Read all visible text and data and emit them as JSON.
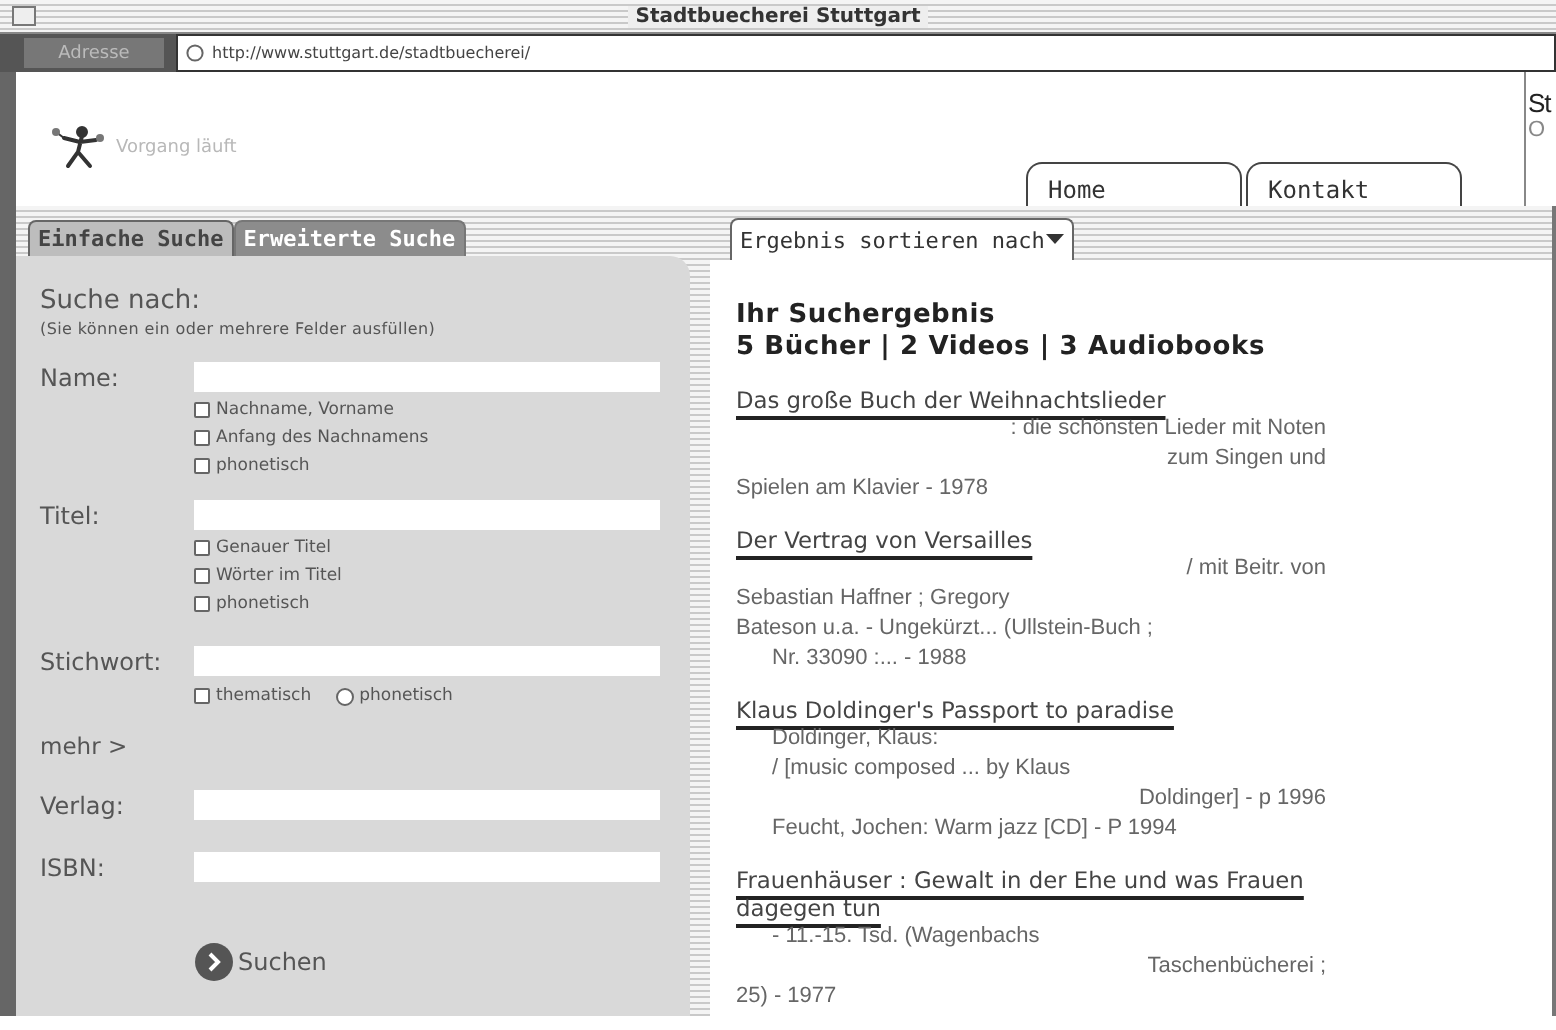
{
  "window": {
    "title": "Stadtbuecherei Stuttgart"
  },
  "address_bar": {
    "button": "Adresse",
    "url": "http://www.stuttgart.de/stadtbuecherei/"
  },
  "header": {
    "status": "Vorgang läuft",
    "nav": [
      "Home",
      "Kontakt"
    ],
    "edge_texts": [
      "St",
      "O"
    ]
  },
  "search_tabs": [
    {
      "label": "Einfache Suche",
      "selected": true
    },
    {
      "label": "Erweiterte Suche",
      "selected": false
    }
  ],
  "form": {
    "heading": "Suche nach:",
    "hint": "(Sie können ein oder mehrere Felder ausfüllen)",
    "submit": "Suchen",
    "rows": [
      {
        "kind": "field",
        "label": "Name:",
        "inline": false,
        "options": [
          {
            "label": "Nachname, Vorname",
            "kind": "checkbox",
            "checked": false
          },
          {
            "label": "Anfang des Nachnamens",
            "kind": "checkbox",
            "checked": false
          },
          {
            "label": "phonetisch",
            "kind": "checkbox",
            "checked": false
          }
        ]
      },
      {
        "kind": "field",
        "label": "Titel:",
        "inline": false,
        "options": [
          {
            "label": "Genauer Titel",
            "kind": "checkbox",
            "checked": false
          },
          {
            "label": "Wörter im Titel",
            "kind": "checkbox",
            "checked": false
          },
          {
            "label": "phonetisch",
            "kind": "checkbox",
            "checked": false
          }
        ]
      },
      {
        "kind": "field",
        "label": "Stichwort:",
        "inline": true,
        "options": [
          {
            "label": "thematisch",
            "kind": "checkbox",
            "checked": false
          },
          {
            "label": "phonetisch",
            "kind": "radio",
            "checked": false
          }
        ]
      },
      {
        "kind": "link",
        "label": "mehr >"
      },
      {
        "kind": "field",
        "label": "Verlag:"
      },
      {
        "kind": "field",
        "label": "ISBN:"
      }
    ]
  },
  "results": {
    "sort_tab": "Ergebnis sortieren nach",
    "heading": "Ihr Suchergebnis",
    "summary": "5 Bücher | 2 Videos | 3 Audiobooks",
    "items": [
      {
        "title": "Das große Buch der Weihnachtslieder",
        "lines": [
          {
            "text": ": die schönsten Lieder mit Noten",
            "kind": "right"
          },
          {
            "text": "zum Singen und",
            "kind": "right"
          },
          {
            "text": "Spielen am Klavier - 1978",
            "kind": "plain"
          }
        ]
      },
      {
        "title": "Der Vertrag von Versailles",
        "lines": [
          {
            "text": "/ mit Beitr. von",
            "kind": "right"
          },
          {
            "text": "Sebastian Haffner ; Gregory",
            "kind": "plain"
          },
          {
            "text": "Bateson u.a. - Ungekürzt... (Ullstein-Buch ;",
            "kind": "plain"
          },
          {
            "text": "Nr. 33090 :... - 1988",
            "kind": "indent"
          }
        ]
      },
      {
        "title": "Klaus Doldinger's Passport to paradise",
        "lines": [
          {
            "text": "Doldinger, Klaus:",
            "kind": "indent"
          },
          {
            "text": "/ [music composed ... by Klaus",
            "kind": "indent"
          },
          {
            "text": "Doldinger] - p 1996",
            "kind": "right"
          },
          {
            "text": "Feucht, Jochen: Warm jazz [CD] - P 1994",
            "kind": "indent"
          }
        ]
      },
      {
        "title": "Frauenhäuser : Gewalt in der Ehe und was Frauen dagegen tun",
        "lines": [
          {
            "text": "- 11.-15. Tsd. (Wagenbachs",
            "kind": "indent"
          },
          {
            "text": "Taschenbücherei ;",
            "kind": "right"
          },
          {
            "text": "25) - 1977",
            "kind": "plain"
          }
        ]
      }
    ]
  }
}
